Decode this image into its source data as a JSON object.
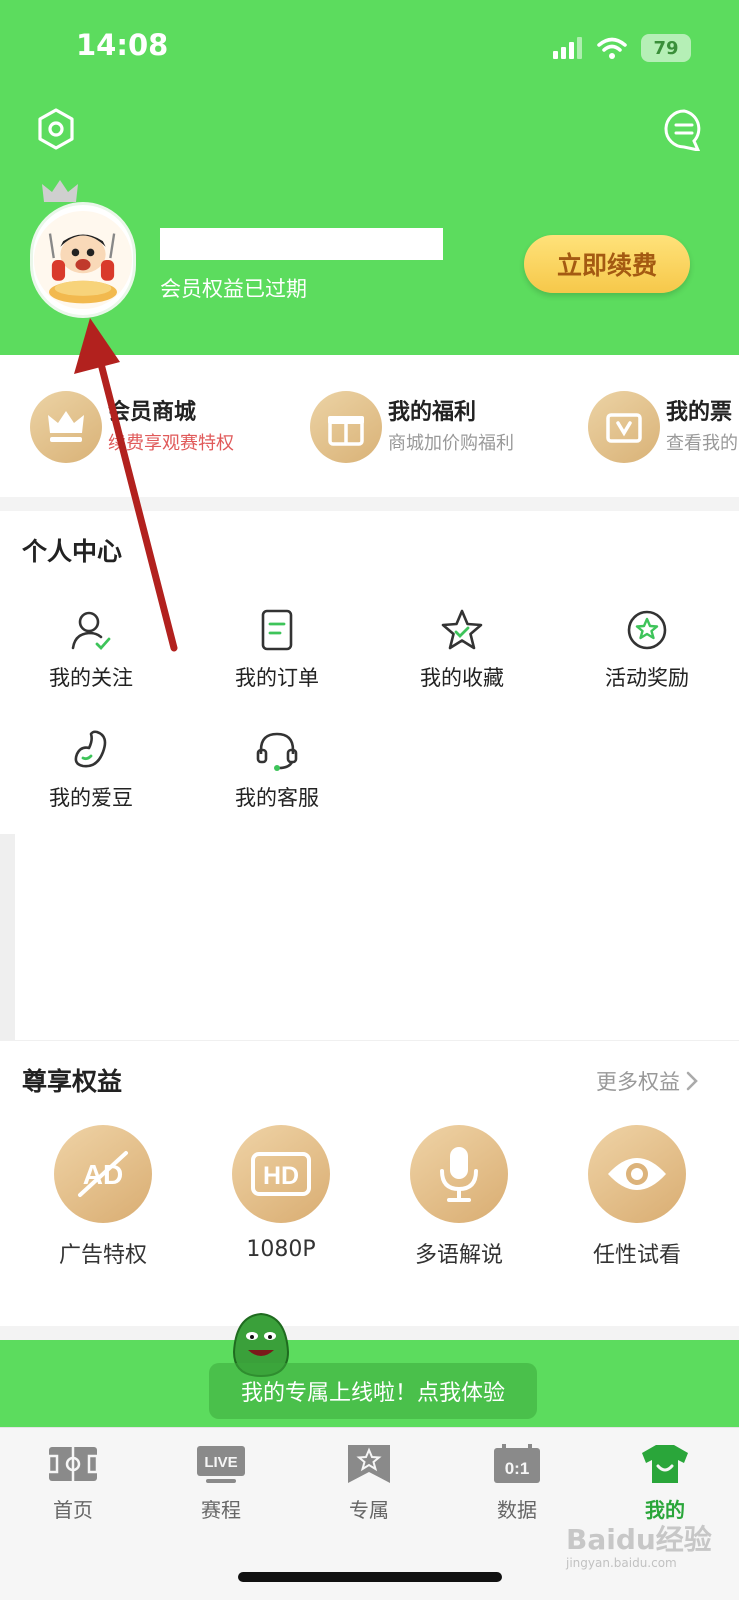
{
  "status_bar": {
    "time": "14:08",
    "battery": "79"
  },
  "header": {
    "member_status": "会员权益已过期",
    "renew_label": "立即续费",
    "icons": [
      "settings-icon",
      "message-icon"
    ]
  },
  "quick_links": [
    {
      "title": "会员商城",
      "subtitle": "续费享观赛特权",
      "icon": "crown-icon"
    },
    {
      "title": "我的福利",
      "subtitle": "商城加价购福利",
      "icon": "gift-icon"
    },
    {
      "title": "我的票",
      "subtitle": "查看我的",
      "icon": "ticket-icon"
    }
  ],
  "personal_center": {
    "title": "个人中心",
    "items": [
      {
        "label": "我的关注",
        "icon": "follow-user-icon"
      },
      {
        "label": "我的订单",
        "icon": "order-icon"
      },
      {
        "label": "我的收藏",
        "icon": "star-icon"
      },
      {
        "label": "活动奖励",
        "icon": "reward-badge-icon"
      },
      {
        "label": "我的爱豆",
        "icon": "bean-icon"
      },
      {
        "label": "我的客服",
        "icon": "headset-icon"
      }
    ]
  },
  "benefits": {
    "title": "尊享权益",
    "more_label": "更多权益",
    "items": [
      {
        "label": "广告特权",
        "icon": "no-ad-icon",
        "glyph": "AD"
      },
      {
        "label": "1080P",
        "icon": "hd-icon",
        "glyph": "HD"
      },
      {
        "label": "多语解说",
        "icon": "microphone-icon"
      },
      {
        "label": "任性试看",
        "icon": "eye-icon"
      }
    ]
  },
  "promo": {
    "text": "我的专属上线啦！点我体验"
  },
  "tabbar": {
    "tabs": [
      {
        "label": "首页",
        "icon": "field-icon"
      },
      {
        "label": "赛程",
        "icon": "live-icon",
        "glyph": "LIVE"
      },
      {
        "label": "专属",
        "icon": "bookmark-star-icon"
      },
      {
        "label": "数据",
        "icon": "scoreboard-icon",
        "glyph": "0:1"
      },
      {
        "label": "我的",
        "icon": "jersey-icon"
      }
    ],
    "active": "我的"
  },
  "watermark": {
    "text": "Baidu经验",
    "sub": "jingyan.baidu.com"
  },
  "colors": {
    "brand_green": "#5cdc5e",
    "gold": "#d9b277",
    "active_tab": "#2aa63a",
    "arrow": "#b2211e"
  }
}
